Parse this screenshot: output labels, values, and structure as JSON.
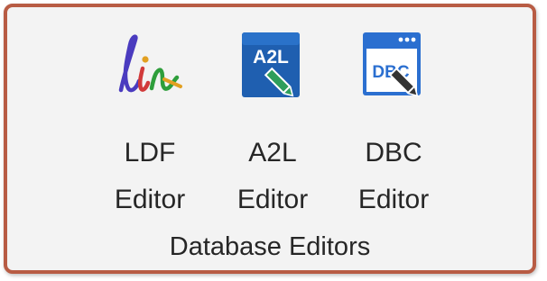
{
  "group": {
    "label": "Database Editors"
  },
  "buttons": [
    {
      "line1": "LDF",
      "line2": "Editor",
      "icon": "lin-icon",
      "icon_text": "lin"
    },
    {
      "line1": "A2L",
      "line2": "Editor",
      "icon": "a2l-edit-icon",
      "icon_text": "A2L"
    },
    {
      "line1": "DBC",
      "line2": "Editor",
      "icon": "dbc-edit-icon",
      "icon_text": "DBC"
    }
  ],
  "colors": {
    "border": "#b85c44",
    "background": "#f3f3f3",
    "a2l_blue": "#1f5fb0",
    "dbc_blue": "#2b6fd0",
    "pencil_green": "#2e9e5b"
  }
}
